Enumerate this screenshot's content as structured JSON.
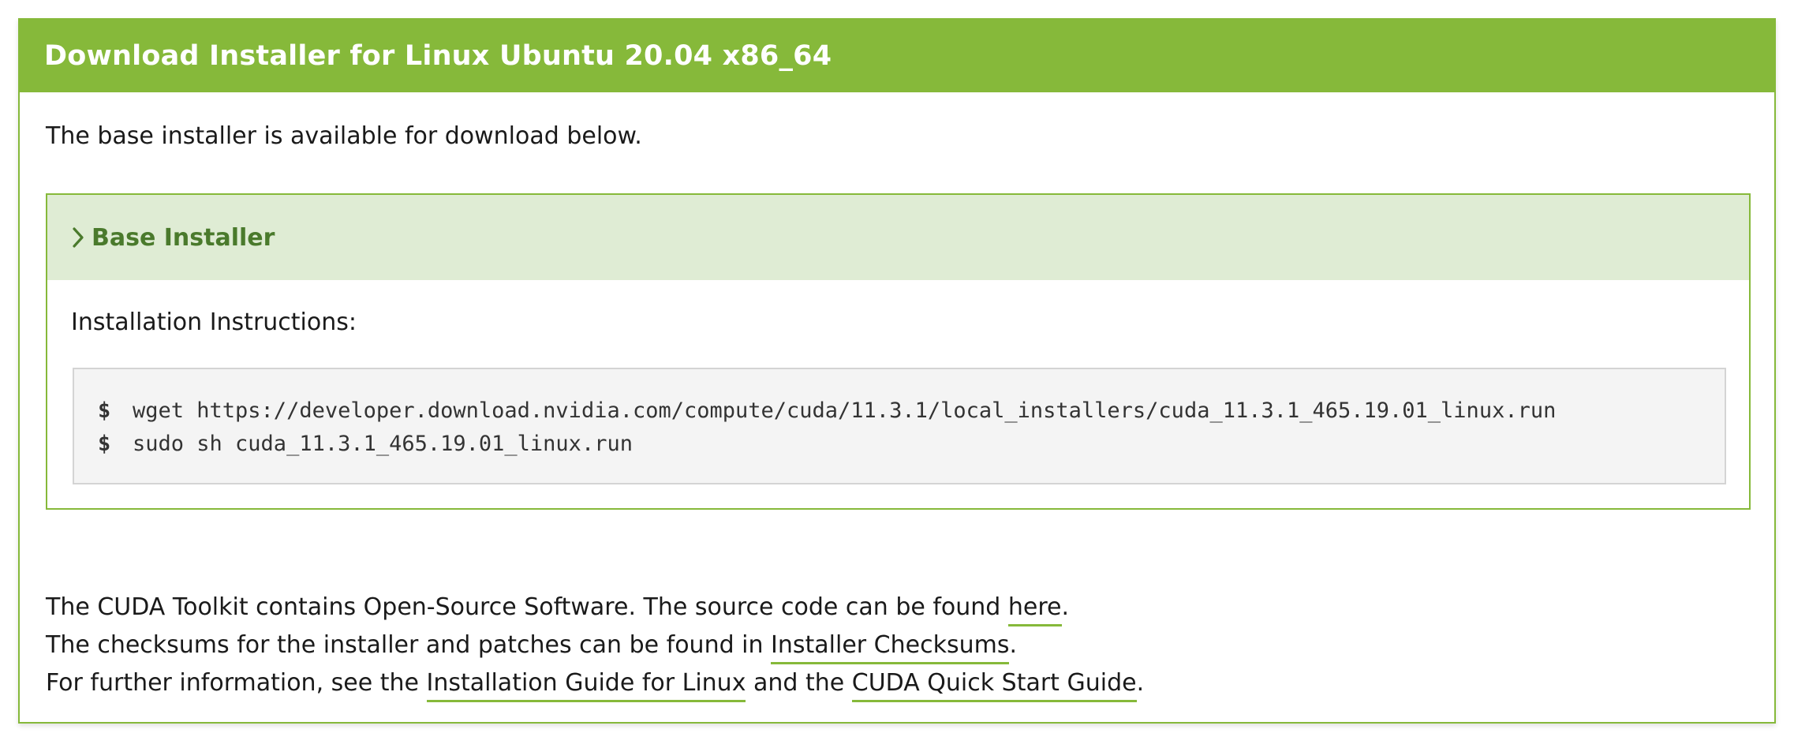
{
  "header": {
    "title": "Download Installer for Linux Ubuntu 20.04 x86_64"
  },
  "intro_text": "The base installer is available for download below.",
  "base_installer": {
    "toggle_icon": "chevron-right-icon",
    "title": "Base Installer",
    "instructions_label": "Installation Instructions:",
    "commands": [
      {
        "prompt": "$",
        "text": "wget https://developer.download.nvidia.com/compute/cuda/11.3.1/local_installers/cuda_11.3.1_465.19.01_linux.run"
      },
      {
        "prompt": "$",
        "text": "sudo sh cuda_11.3.1_465.19.01_linux.run"
      }
    ]
  },
  "footer": {
    "line1_prefix": "The CUDA Toolkit contains Open-Source Software. The source code can be found ",
    "line1_link": "here",
    "line1_suffix": ".",
    "line2_prefix": "The checksums for the installer and patches can be found in ",
    "line2_link": "Installer Checksums",
    "line2_suffix": ".",
    "line3_prefix": "For further information, see the ",
    "line3_link1": "Installation Guide for Linux",
    "line3_middle": " and the ",
    "line3_link2": "CUDA Quick Start Guide",
    "line3_suffix": "."
  },
  "colors": {
    "accent": "#86b93a",
    "accent_light": "#dfecd4",
    "accent_dark_text": "#4a7a2c",
    "code_background": "#f4f4f4"
  }
}
